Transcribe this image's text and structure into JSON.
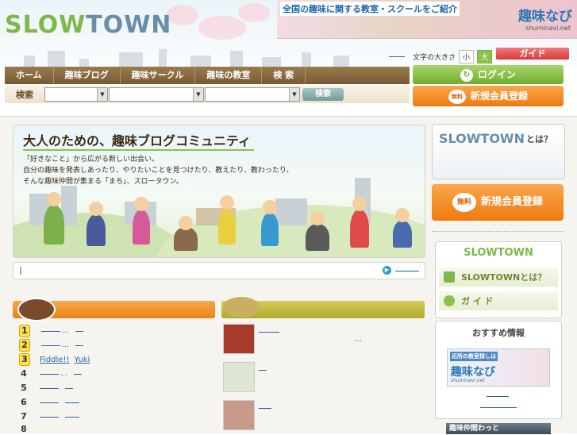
{
  "header": {
    "logo_prefix": "SLOW",
    "logo_suffix": "TOWN",
    "banner": {
      "text": "全国の趣味に関する教室・スクールをご紹介",
      "brand": "趣味なび",
      "url": "shuminavi.net"
    },
    "font_size": {
      "label": "文字の大きさ",
      "small": "小",
      "large": "大"
    },
    "guide_label": "ガイド"
  },
  "nav": {
    "items": [
      {
        "label": "ホーム"
      },
      {
        "label": "趣味ブログ"
      },
      {
        "label": "趣味サークル"
      },
      {
        "label": "趣味の教室"
      },
      {
        "label": "検 索"
      }
    ]
  },
  "search": {
    "label": "検索",
    "button": "検索"
  },
  "account": {
    "login": "ログイン",
    "register": "新規会員登録",
    "free": "無料"
  },
  "hero": {
    "title": "大人のための、趣味ブログコミュニティ",
    "line1": "「好きなこと」から広がる新しい出会い。",
    "line2": "自分の趣味を発表しあったり、やりたいことを見つけたり、教えたり、教わったり、",
    "line3": "そんな趣味仲間が集まる「まち」、スロータウン。"
  },
  "ranking": {
    "items": [
      {
        "rank": "1",
        "extra": "…"
      },
      {
        "rank": "2",
        "extra": "…"
      },
      {
        "rank": "3",
        "extra": "Fiddle!!",
        "extra2": "Yuki"
      },
      {
        "rank": "4",
        "extra": "…"
      },
      {
        "rank": "5",
        "extra": ""
      },
      {
        "rank": "6",
        "extra": ""
      },
      {
        "rank": "7",
        "extra": ""
      },
      {
        "rank": "8",
        "extra": ""
      }
    ]
  },
  "new_posts": {
    "ellipsis": "…"
  },
  "sidebar": {
    "about_logo": "SLOWTOWN",
    "about_suffix": "とは？",
    "register": "新規会員登録",
    "free": "無料",
    "box_logo": "SLOWTOWN",
    "box_items": [
      {
        "label": "SLOWTOWNとは？"
      },
      {
        "label": "ガ イ ド"
      }
    ],
    "recommend_title": "おすすめ情報",
    "rec_ad": {
      "text": "近所の教室探しは",
      "brand": "趣味なび",
      "url": "shuminavi.net"
    },
    "bottom_label": "趣味仲間わっと"
  },
  "colors": {
    "nav_brown": "#7a5a33",
    "green": "#7db84a",
    "orange": "#ee7a10",
    "link_blue": "#2a5fb0"
  }
}
